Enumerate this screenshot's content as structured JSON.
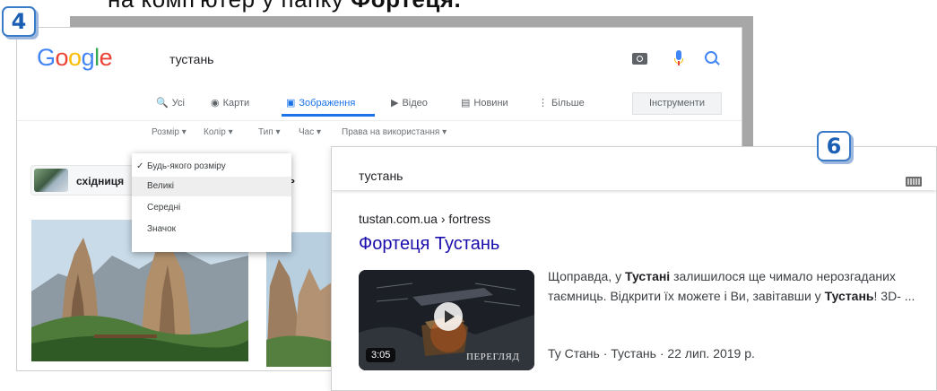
{
  "caption": {
    "text": "на комп'ютер у папку ",
    "bold": "Фортеця."
  },
  "badges": {
    "left": "4",
    "right": "6"
  },
  "google": {
    "logo": [
      "G",
      "o",
      "o",
      "g",
      "l",
      "e"
    ],
    "query": "тустань",
    "tabs": [
      {
        "icon": "🔍",
        "label": "Усі"
      },
      {
        "icon": "◉",
        "label": "Карти"
      },
      {
        "icon": "▣",
        "label": "Зображення"
      },
      {
        "icon": "▶",
        "label": "Відео"
      },
      {
        "icon": "▤",
        "label": "Новини"
      },
      {
        "icon": "⋮",
        "label": "Більше"
      }
    ],
    "tools_label": "Інструменти",
    "filters": [
      "Розмір ▾",
      "Колір ▾",
      "Тип ▾",
      "Час ▾",
      "Права на використання ▾"
    ],
    "related_chip": "східниця",
    "related_chip_partial": "сть",
    "size_menu": {
      "items": [
        "Будь-якого розміру",
        "Великі",
        "Середні",
        "Значок"
      ],
      "checked_index": 0,
      "hover_index": 1
    }
  },
  "result": {
    "query": "тустань",
    "url": "tustan.com.ua › fortress",
    "title": "Фортеця Тустань",
    "snippet": {
      "p1": "Щоправда, у ",
      "b1": "Тустані",
      "p2": " залишилося ще чимало нерозгаданих таємниць. Відкрити їх можете і Ви, завітавши у ",
      "b2": "Тустань",
      "p3": "! 3D- ..."
    },
    "video": {
      "duration": "3:05",
      "label": "ПЕРЕГЛЯД"
    },
    "meta": "Ту Стань · Тустань · 22 лип. 2019 р."
  }
}
